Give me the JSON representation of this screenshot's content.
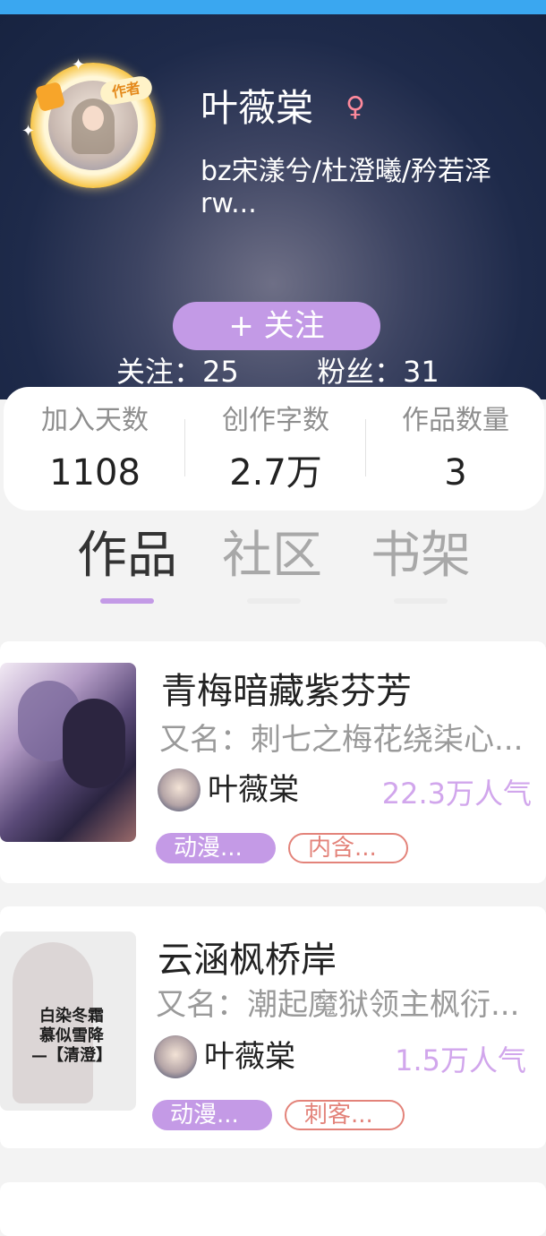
{
  "profile": {
    "name": "叶薇棠",
    "gender_symbol": "♀",
    "bio": "bz宋漾兮/杜澄曦/矜若泽rw...",
    "badge": "作者",
    "follow_button": "+  关注",
    "following": "关注：25",
    "followers": "粉丝：31"
  },
  "stats": [
    {
      "label": "加入天数",
      "value": "1108"
    },
    {
      "label": "创作字数",
      "value": "2.7万"
    },
    {
      "label": "作品数量",
      "value": "3"
    }
  ],
  "tabs": [
    {
      "label": "作品",
      "active": true
    },
    {
      "label": "社区",
      "active": false
    },
    {
      "label": "书架",
      "active": false
    }
  ],
  "works": [
    {
      "title": "青梅暗藏紫芬芳",
      "alias": "又名：刺七之梅花绕柒心...",
      "author": "叶薇棠",
      "popularity": "22.3万人气",
      "tags": [
        "动漫...",
        "内含..."
      ]
    },
    {
      "title": "云涵枫桥岸",
      "alias": "又名：潮起魔狱领主枫衍...",
      "author": "叶薇棠",
      "popularity": "1.5万人气",
      "tags": [
        "动漫...",
        "刺客..."
      ],
      "cover_text": [
        "白染冬霜",
        "慕似雪降",
        "—【清澄】"
      ]
    }
  ],
  "colors": {
    "accent": "#c39ae6",
    "tag_outline": "#e3837a",
    "top_bar": "#3aa7f0"
  }
}
